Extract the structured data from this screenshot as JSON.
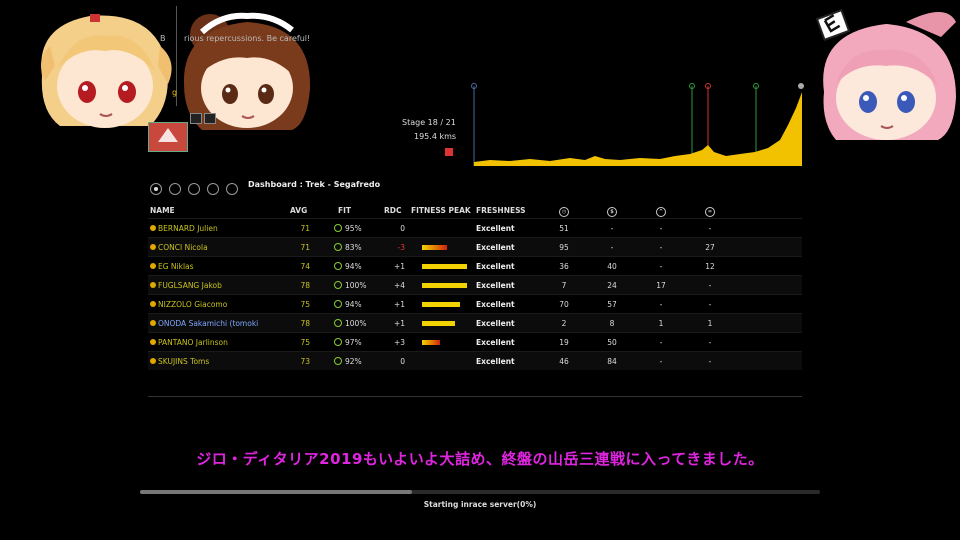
{
  "header": {
    "warning": "rious repercussions. Be careful!",
    "warning_prefix": "B",
    "yellow_mark": "g"
  },
  "stage": {
    "label": "Stage 18 / 21",
    "distance": "195.4 kms"
  },
  "dashboard": {
    "title": "Dashboard : Trek - Segafredo",
    "dots_count": 5,
    "active_dot": 0
  },
  "table": {
    "headers": {
      "name": "NAME",
      "avg": "AVG",
      "fit": "FIT",
      "rdc": "RDC",
      "fitness_peak": "FITNESS PEAK",
      "freshness": "FRESHNESS",
      "icon1": "clock-icon",
      "icon2": "dollar-icon",
      "icon3": "mountain-icon",
      "icon4": "flat-icon"
    },
    "rows": [
      {
        "name": "BERNARD Julien",
        "avg": "71",
        "fit": "95%",
        "rdc": "0",
        "peak": 0,
        "fresh": "Excellent",
        "v1": "51",
        "v2": "-",
        "v3": "-",
        "v4": "-"
      },
      {
        "name": "CONCI Nicola",
        "avg": "71",
        "fit": "83%",
        "rdc": "-3",
        "peak": 0.5,
        "fresh": "Excellent",
        "v1": "95",
        "v2": "-",
        "v3": "-",
        "v4": "27"
      },
      {
        "name": "EG Niklas",
        "avg": "74",
        "fit": "94%",
        "rdc": "+1",
        "peak": 0.9,
        "fresh": "Excellent",
        "v1": "36",
        "v2": "40",
        "v3": "-",
        "v4": "12"
      },
      {
        "name": "FUGLSANG Jakob",
        "avg": "78",
        "fit": "100%",
        "rdc": "+4",
        "peak": 0.9,
        "fresh": "Excellent",
        "v1": "7",
        "v2": "24",
        "v3": "17",
        "v4": "-"
      },
      {
        "name": "NIZZOLO Giacomo",
        "avg": "75",
        "fit": "94%",
        "rdc": "+1",
        "peak": 0.75,
        "fresh": "Excellent",
        "v1": "70",
        "v2": "57",
        "v3": "-",
        "v4": "-"
      },
      {
        "name": "ONODA Sakamichi (tomoki",
        "avg": "78",
        "fit": "100%",
        "rdc": "+1",
        "peak": 0.65,
        "fresh": "Excellent",
        "v1": "2",
        "v2": "8",
        "v3": "1",
        "v4": "1"
      },
      {
        "name": "PANTANO Jarlinson",
        "avg": "75",
        "fit": "97%",
        "rdc": "+3",
        "peak": 0.35,
        "fresh": "Excellent",
        "v1": "19",
        "v2": "50",
        "v3": "-",
        "v4": "-"
      },
      {
        "name": "SKUJINS Toms",
        "avg": "73",
        "fit": "92%",
        "rdc": "0",
        "peak": 0,
        "fresh": "Excellent",
        "v1": "46",
        "v2": "84",
        "v3": "-",
        "v4": "-"
      }
    ]
  },
  "subtitle": "ジロ・ディタリア2019もいよいよ大詰め、終盤の山岳三連戦に入ってきました。",
  "status": {
    "text": "Starting inrace server(0%)",
    "progress": 0.4
  },
  "colors": {
    "profile_fill": "#f2c200",
    "name_yellow": "#c9c21e",
    "name_blue": "#7fa6ff",
    "subtitle": "#e025e0"
  }
}
